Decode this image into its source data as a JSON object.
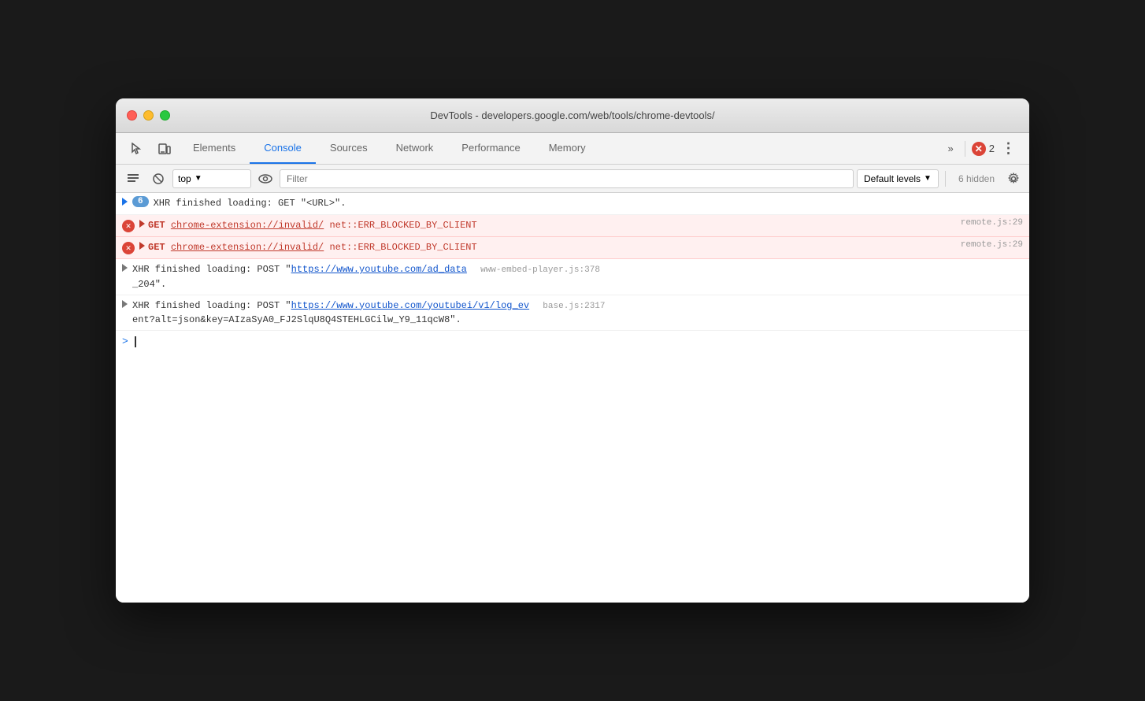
{
  "window": {
    "title": "DevTools - developers.google.com/web/tools/chrome-devtools/"
  },
  "tabs": [
    {
      "id": "elements",
      "label": "Elements",
      "active": false
    },
    {
      "id": "console",
      "label": "Console",
      "active": true
    },
    {
      "id": "sources",
      "label": "Sources",
      "active": false
    },
    {
      "id": "network",
      "label": "Network",
      "active": false
    },
    {
      "id": "performance",
      "label": "Performance",
      "active": false
    },
    {
      "id": "memory",
      "label": "Memory",
      "active": false
    }
  ],
  "error_count": "2",
  "console_toolbar": {
    "context": "top",
    "filter_placeholder": "Filter",
    "levels": "Default levels",
    "hidden": "6 hidden"
  },
  "console_rows": [
    {
      "type": "info",
      "badge": "6",
      "text": "XHR finished loading: GET \"<URL>\".",
      "source": null
    },
    {
      "type": "error",
      "arrow": true,
      "method": "GET",
      "url": "chrome-extension://invalid/",
      "error": "net::ERR_BLOCKED_BY_CLIENT",
      "source": "remote.js:29"
    },
    {
      "type": "error",
      "arrow": true,
      "method": "GET",
      "url": "chrome-extension://invalid/",
      "error": "net::ERR_BLOCKED_BY_CLIENT",
      "source": "remote.js:29"
    },
    {
      "type": "info",
      "arrow": true,
      "text_prefix": "XHR finished loading: POST \"",
      "url": "https://www.youtube.com/ad_data",
      "text_suffix": " www-embed-player.js:378",
      "source_inline": "_204\".",
      "full_text": "XHR finished loading: POST \"https://www.youtube.com/ad_data www-embed-player.js:378\n_204\"."
    },
    {
      "type": "info",
      "arrow": true,
      "full_text": "XHR finished loading: POST \"https://www.youtube.com/youtubei/v1/log_ev base.js:2317\nent?alt=json&key=AIzaSyA0_FJ2SlqU8Q4STEHLGCilw_Y9_11qcW8\"."
    }
  ]
}
